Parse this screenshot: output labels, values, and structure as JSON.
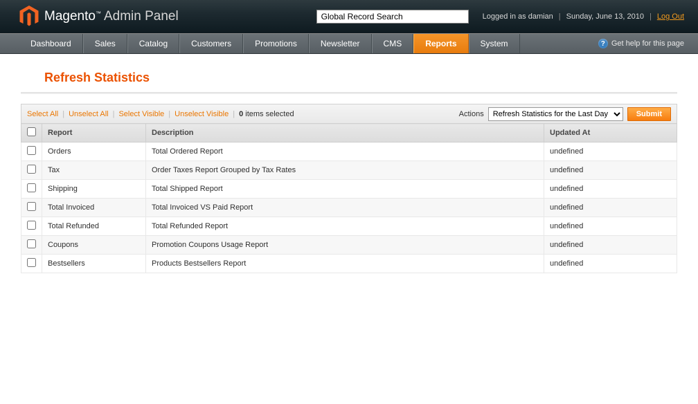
{
  "header": {
    "brand": "Magento",
    "panel": "Admin Panel",
    "search_placeholder": "Global Record Search",
    "logged_in": "Logged in as damian",
    "date": "Sunday, June 13, 2010",
    "logout": "Log Out"
  },
  "nav": {
    "items": [
      "Dashboard",
      "Sales",
      "Catalog",
      "Customers",
      "Promotions",
      "Newsletter",
      "CMS",
      "Reports",
      "System"
    ],
    "active_index": 7,
    "help": "Get help for this page"
  },
  "page": {
    "title": "Refresh Statistics"
  },
  "massaction": {
    "select_all": "Select All",
    "unselect_all": "Unselect All",
    "select_visible": "Select Visible",
    "unselect_visible": "Unselect Visible",
    "selected_count": "0",
    "selected_suffix": " items selected",
    "actions_label": "Actions",
    "action_selected": "Refresh Statistics for the Last Day",
    "submit": "Submit"
  },
  "grid": {
    "columns": [
      "",
      "Report",
      "Description",
      "Updated At"
    ],
    "rows": [
      {
        "report": "Orders",
        "description": "Total Ordered Report",
        "updated": "undefined"
      },
      {
        "report": "Tax",
        "description": "Order Taxes Report Grouped by Tax Rates",
        "updated": "undefined"
      },
      {
        "report": "Shipping",
        "description": "Total Shipped Report",
        "updated": "undefined"
      },
      {
        "report": "Total Invoiced",
        "description": "Total Invoiced VS Paid Report",
        "updated": "undefined"
      },
      {
        "report": "Total Refunded",
        "description": "Total Refunded Report",
        "updated": "undefined"
      },
      {
        "report": "Coupons",
        "description": "Promotion Coupons Usage Report",
        "updated": "undefined"
      },
      {
        "report": "Bestsellers",
        "description": "Products Bestsellers Report",
        "updated": "undefined"
      }
    ]
  }
}
